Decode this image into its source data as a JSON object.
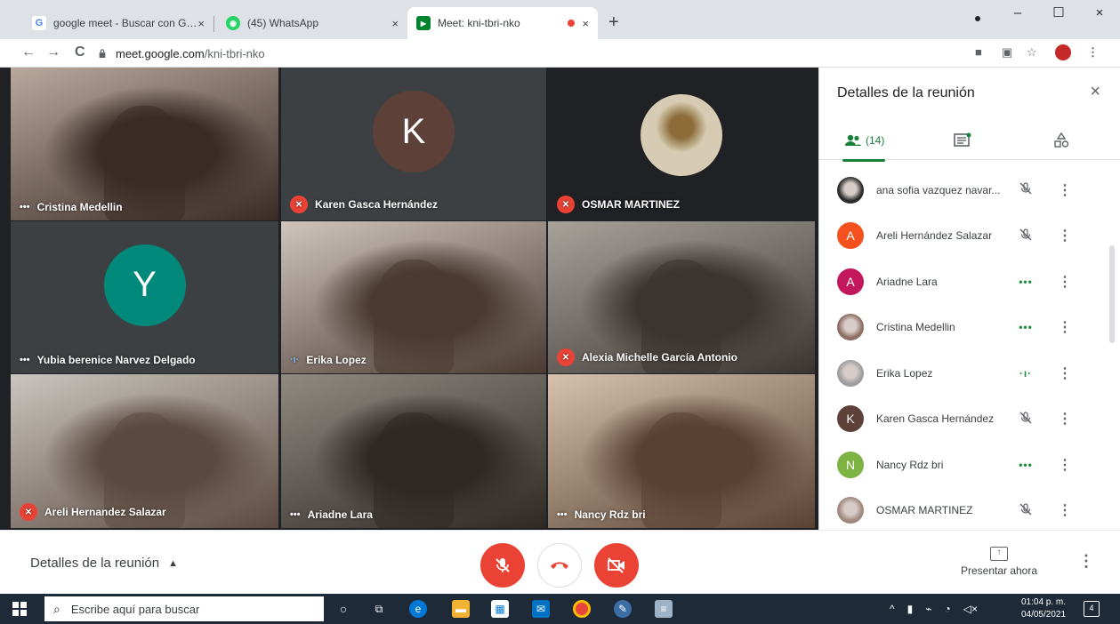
{
  "browser": {
    "tabs": [
      {
        "title": "google meet - Buscar con Google",
        "favicon_letter": "G",
        "favicon_color": "#4285f4"
      },
      {
        "title": "(45) WhatsApp",
        "favicon_letter": "◉",
        "favicon_color": "#25d366"
      },
      {
        "title": "Meet: kni-tbri-nko",
        "favicon_letter": "▶",
        "favicon_color": "#00832d"
      }
    ],
    "url_host": "meet.google.com",
    "url_path": "/kni-tbri-nko",
    "tab_close": "×",
    "new_tab": "+",
    "back": "←",
    "forward": "→",
    "reload": "C",
    "window_minimize": "–",
    "window_maximize": "☐",
    "window_close": "×"
  },
  "tiles": [
    {
      "name": "Cristina Medellin",
      "type": "video",
      "indicator": "dots",
      "colors": [
        "#b8a89c",
        "#3a2b26"
      ]
    },
    {
      "name": "Karen Gasca Hernández",
      "type": "avatar",
      "indicator": "muted",
      "letter": "K",
      "avatar_color": "#5d4037"
    },
    {
      "name": "OSMAR MARTINEZ",
      "type": "photo",
      "indicator": "muted",
      "colors": [
        "#d7ccb3",
        "#8c6d3a"
      ]
    },
    {
      "name": "Yubia berenice Narvez Delgado",
      "type": "avatar",
      "indicator": "dots",
      "letter": "Y",
      "avatar_color": "#00897b"
    },
    {
      "name": "Erika Lopez",
      "type": "video",
      "indicator": "speaking",
      "colors": [
        "#cfc5bd",
        "#4a3a32"
      ]
    },
    {
      "name": "Alexia Michelle García Antonio",
      "type": "video",
      "indicator": "muted",
      "colors": [
        "#a7a39b",
        "#3b3532"
      ]
    },
    {
      "name": "Areli Hernandez Salazar",
      "type": "video",
      "indicator": "muted",
      "colors": [
        "#c9c5bf",
        "#5c4a40"
      ]
    },
    {
      "name": "Ariadne Lara",
      "type": "video",
      "indicator": "dots",
      "colors": [
        "#8f8a82",
        "#2f2824"
      ]
    },
    {
      "name": "Nancy Rdz bri",
      "type": "video",
      "indicator": "dots",
      "colors": [
        "#d6c2ad",
        "#5a4233"
      ]
    }
  ],
  "panel": {
    "title": "Detalles de la reunión",
    "close": "×",
    "people_count": "(14)",
    "people": [
      {
        "name": "ana sofia vazquez navar...",
        "status": "muted",
        "avatar": "photo",
        "color": "#2b2b2b"
      },
      {
        "name": "Areli Hernández Salazar",
        "status": "muted",
        "avatar": "A",
        "color": "#f4511e"
      },
      {
        "name": "Ariadne Lara",
        "status": "dots",
        "avatar": "A",
        "color": "#c2185b"
      },
      {
        "name": "Cristina Medellin",
        "status": "dots",
        "avatar": "photo",
        "color": "#8d6e63"
      },
      {
        "name": "Erika Lopez",
        "status": "speaking",
        "avatar": "photo",
        "color": "#9e9e9e"
      },
      {
        "name": "Karen Gasca Hernández",
        "status": "muted",
        "avatar": "K",
        "color": "#5d4037"
      },
      {
        "name": "Nancy Rdz bri",
        "status": "dots",
        "avatar": "N",
        "color": "#7cb342"
      },
      {
        "name": "OSMAR MARTINEZ",
        "status": "muted",
        "avatar": "photo",
        "color": "#a1887f"
      }
    ]
  },
  "bottom": {
    "details_label": "Detalles de la reunión",
    "present_label": "Presentar ahora"
  },
  "taskbar": {
    "search_placeholder": "Escribe aquí para buscar",
    "time": "01:04 p. m.",
    "date": "04/05/2021",
    "notifications": "4"
  }
}
